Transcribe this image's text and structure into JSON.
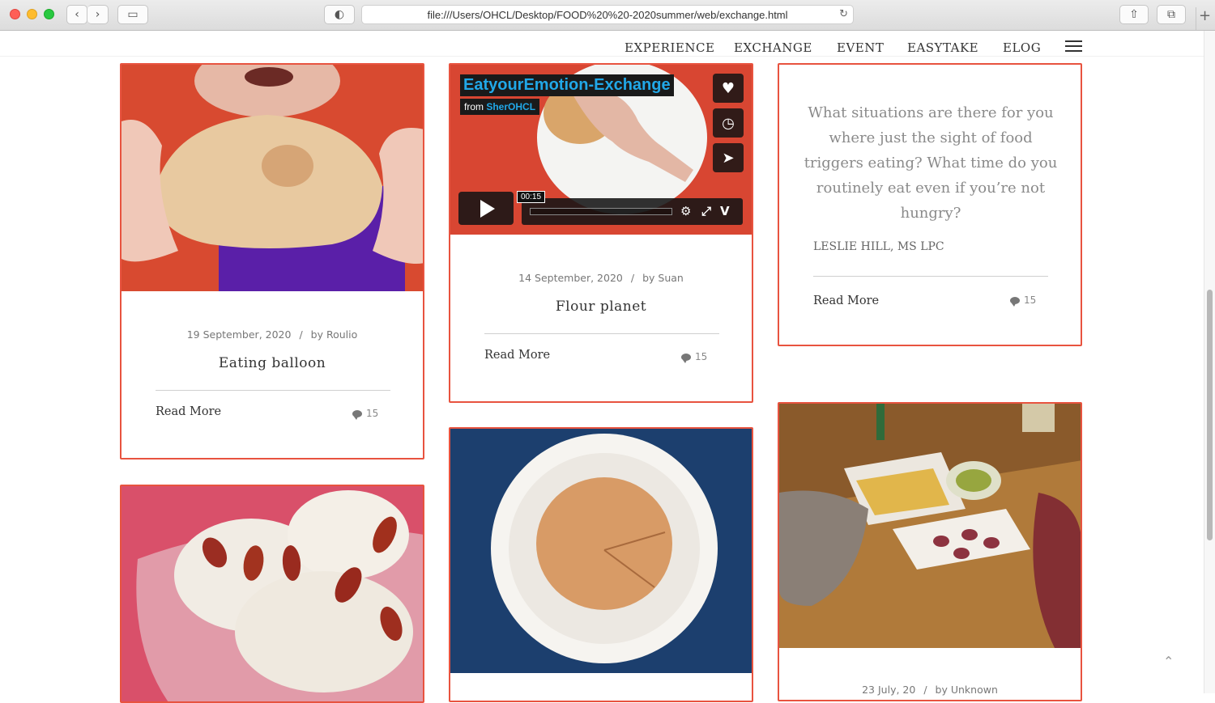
{
  "browser": {
    "url": "file:///Users/OHCL/Desktop/FOOD%20%20-2020summer/web/exchange.html"
  },
  "nav": {
    "items": [
      "EXPERIENCE",
      "EXCHANGE",
      "EVENT",
      "EASYTAKE",
      "ELOG"
    ]
  },
  "cards": [
    {
      "date": "19 September, 2020",
      "separator": "/",
      "author": "by Roulio",
      "title": "Eating balloon",
      "read_more": "Read More",
      "comments": "15"
    },
    {
      "video": {
        "title": "EatyourEmotion-Exchange",
        "from_label": "from",
        "from_channel": "SherOHCL",
        "time": "00:15"
      },
      "date": "14 September, 2020",
      "separator": "/",
      "author": "by Suan",
      "title": "Flour planet",
      "read_more": "Read More",
      "comments": "15"
    },
    {
      "quote": "What situations are there for you where just the sight of food triggers eating? What time do you routinely eat even if you’re not hungry?",
      "quote_author": "LESLIE HILL, MS LPC",
      "read_more": "Read More",
      "comments": "15"
    },
    {
      "date": "23 July, 20",
      "separator": "/",
      "author": "by Unknown"
    }
  ],
  "colors": {
    "card_border": "#e8533f",
    "video_accent": "#21a8e8"
  }
}
